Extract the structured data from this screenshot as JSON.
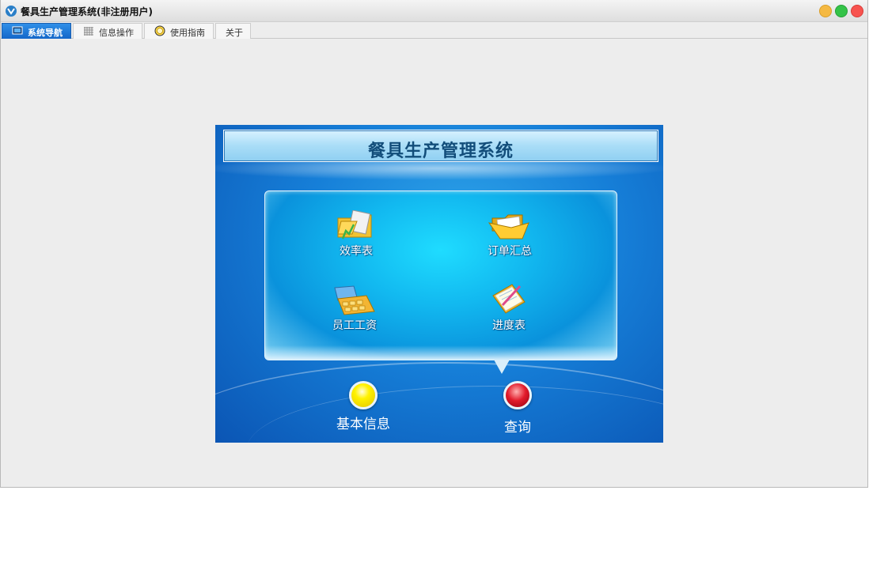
{
  "window": {
    "title": "餐具生产管理系统(非注册用户)"
  },
  "tabs": [
    {
      "label": "系统导航",
      "icon": "monitor-icon",
      "active": true
    },
    {
      "label": "信息操作",
      "icon": "grid-icon",
      "active": false
    },
    {
      "label": "使用指南",
      "icon": "compass-icon",
      "active": false
    },
    {
      "label": "关于",
      "icon": "",
      "active": false
    }
  ],
  "panel": {
    "title": "餐具生产管理系统",
    "menu_items": [
      {
        "label": "效率表",
        "icon": "folder-chart-icon"
      },
      {
        "label": "订单汇总",
        "icon": "open-folder-icon"
      },
      {
        "label": "员工工资",
        "icon": "calculator-icon"
      },
      {
        "label": "进度表",
        "icon": "notepad-icon"
      }
    ],
    "bottom_buttons": [
      {
        "label": "基本信息",
        "icon": "yellow-orb-icon"
      },
      {
        "label": "查询",
        "icon": "red-orb-icon"
      }
    ]
  },
  "colors": {
    "panel_blue": "#167fd8",
    "menu_cyan": "#12b9f0",
    "title_text": "#124d7a",
    "active_tab": "#1467c9"
  }
}
